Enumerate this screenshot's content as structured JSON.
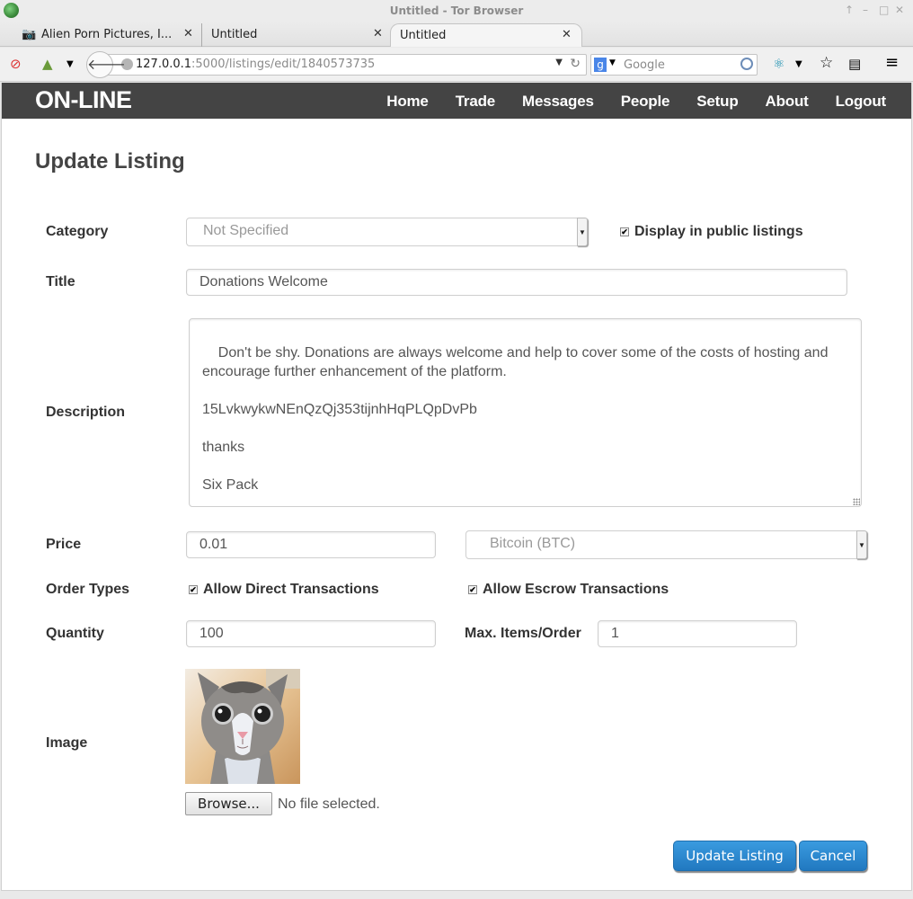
{
  "window": {
    "title": "Untitled - Tor Browser",
    "controls": [
      "↑",
      "–",
      "□",
      "✕"
    ]
  },
  "tabs": [
    {
      "label": "Alien Porn Pictures, I...",
      "icon": "camera-icon",
      "active": false
    },
    {
      "label": "Untitled",
      "active": false
    },
    {
      "label": "Untitled",
      "active": true
    }
  ],
  "toolbar": {
    "url_host": "127.0.0.1",
    "url_rest": ":5000/listings/edit/1840573735",
    "search_placeholder": "Google",
    "new_tab_icon": "plus-icon"
  },
  "site": {
    "brand": "ON-LINE",
    "nav": [
      "Home",
      "Trade",
      "Messages",
      "People",
      "Setup",
      "About",
      "Logout"
    ]
  },
  "form": {
    "heading": "Update Listing",
    "category": {
      "label": "Category",
      "value": "Not Specified"
    },
    "public": {
      "label": "Display in public listings",
      "checked": true
    },
    "title": {
      "label": "Title",
      "value": "Donations Welcome"
    },
    "description": {
      "label": "Description",
      "value": "Don't be shy. Donations are always welcome and help to cover some of the costs of hosting and encourage further enhancement of the platform.\n\n15LvkwykwNEnQzQj353tijnhHqPLQpDvPb\n\nthanks\n\nSix Pack"
    },
    "price": {
      "label": "Price",
      "value": "0.01",
      "currency": "Bitcoin (BTC)"
    },
    "order_types": {
      "label": "Order Types",
      "direct": {
        "label": "Allow Direct Transactions",
        "checked": true
      },
      "escrow": {
        "label": "Allow Escrow Transactions",
        "checked": true
      }
    },
    "quantity": {
      "label": "Quantity",
      "value": "100"
    },
    "max_items": {
      "label": "Max. Items/Order",
      "value": "1"
    },
    "image": {
      "label": "Image",
      "browse_label": "Browse...",
      "file_status": "No file selected."
    },
    "submit_label": "Update Listing",
    "cancel_label": "Cancel"
  },
  "colors": {
    "nav_bg": "#444444",
    "primary_button": "#2a86d0"
  }
}
